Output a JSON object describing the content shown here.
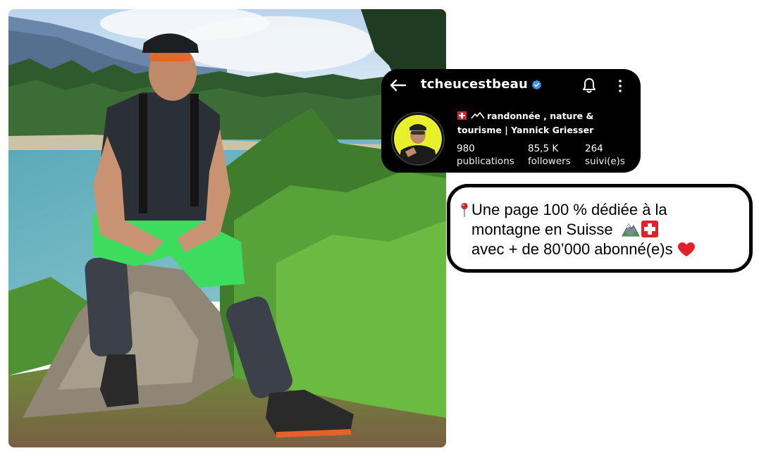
{
  "profile": {
    "username": "tcheucestbeau",
    "verified": true,
    "bio_line1": "randonnée , nature &",
    "bio_line2": "tourisme | Yannick Griesser",
    "stats": [
      {
        "value": "980",
        "label": "publications"
      },
      {
        "value": "85,5 K",
        "label": "followers"
      },
      {
        "value": "264",
        "label": "suivi(e)s"
      }
    ],
    "icons": [
      "back-arrow-icon",
      "verified-badge-icon",
      "bell-icon",
      "more-options-icon",
      "swiss-flag-icon",
      "mountain-icon"
    ]
  },
  "caption": {
    "line1": "Une page 100 % dédiée à la",
    "line2": "montagne en Suisse",
    "line3": "avec + de 80’000 abonné(e)s",
    "icons": [
      "pin-icon",
      "mountain-icon",
      "swiss-flag-icon",
      "heart-icon"
    ]
  },
  "colors": {
    "card_background": "#000000",
    "verified_blue": "#3897f0",
    "swiss_red": "#e0202b",
    "heart_red": "#e0202b"
  }
}
